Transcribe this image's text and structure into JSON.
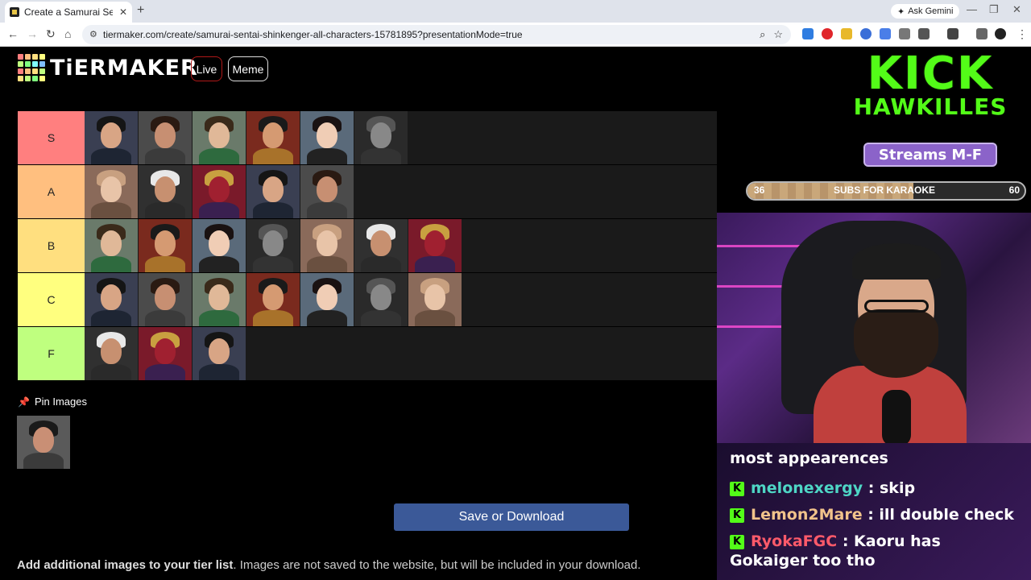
{
  "browser": {
    "tab_title": "Create a Samurai Sentai Shinke",
    "tab_close": "✕",
    "new_tab": "+",
    "gemini_label": "Ask Gemini",
    "url": "tiermaker.com/create/samurai-sentai-shinkenger-all-characters-15781895?presentationMode=true"
  },
  "site": {
    "logo_text": "TiERMAKER",
    "logo_colors": [
      "#ff7f7f",
      "#ffbf7f",
      "#ffdf7f",
      "#ffff7f",
      "#bfff7f",
      "#7fff7f",
      "#7fffff",
      "#7fbfff",
      "#ff7f7f",
      "#ffbf7f",
      "#ffdf7f",
      "#bfff7f",
      "#ffdf7f",
      "#bfff7f",
      "#7fff7f",
      "#ffff7f"
    ],
    "live_label": "Live",
    "meme_label": "Meme"
  },
  "tiers": [
    {
      "label": "S",
      "color": "#ff7f7f",
      "count": 6
    },
    {
      "label": "A",
      "color": "#ffbf7f",
      "count": 5
    },
    {
      "label": "B",
      "color": "#ffdf7f",
      "count": 7
    },
    {
      "label": "C",
      "color": "#ffff7f",
      "count": 7
    },
    {
      "label": "F",
      "color": "#bfff7f",
      "count": 3
    }
  ],
  "pin": {
    "label": "Pin Images"
  },
  "save_button": "Save or Download",
  "add_images": {
    "bold": "Add additional images to your tier list",
    "rest": ". Images are not saved to the website, but will be included in your download."
  },
  "overlay": {
    "kick_word": "KICK",
    "kick_name": "HAWKILLES",
    "streams": "Streams M-F",
    "subs_label": "SUBS FOR KARAOKE",
    "subs_current": "36",
    "subs_goal": "60",
    "subs_progress": 0.6
  },
  "chat": {
    "partial": "most appearences",
    "messages": [
      {
        "user": "melonexergy",
        "color": "#4ed6c5",
        "text": " : skip"
      },
      {
        "user": "Lemon2Mare",
        "color": "#f2c38b",
        "text": " : ill double check"
      },
      {
        "user": "RyokaFGC",
        "color": "#ff5a6a",
        "text": " : Kaoru has Gokaiger too tho"
      }
    ]
  }
}
